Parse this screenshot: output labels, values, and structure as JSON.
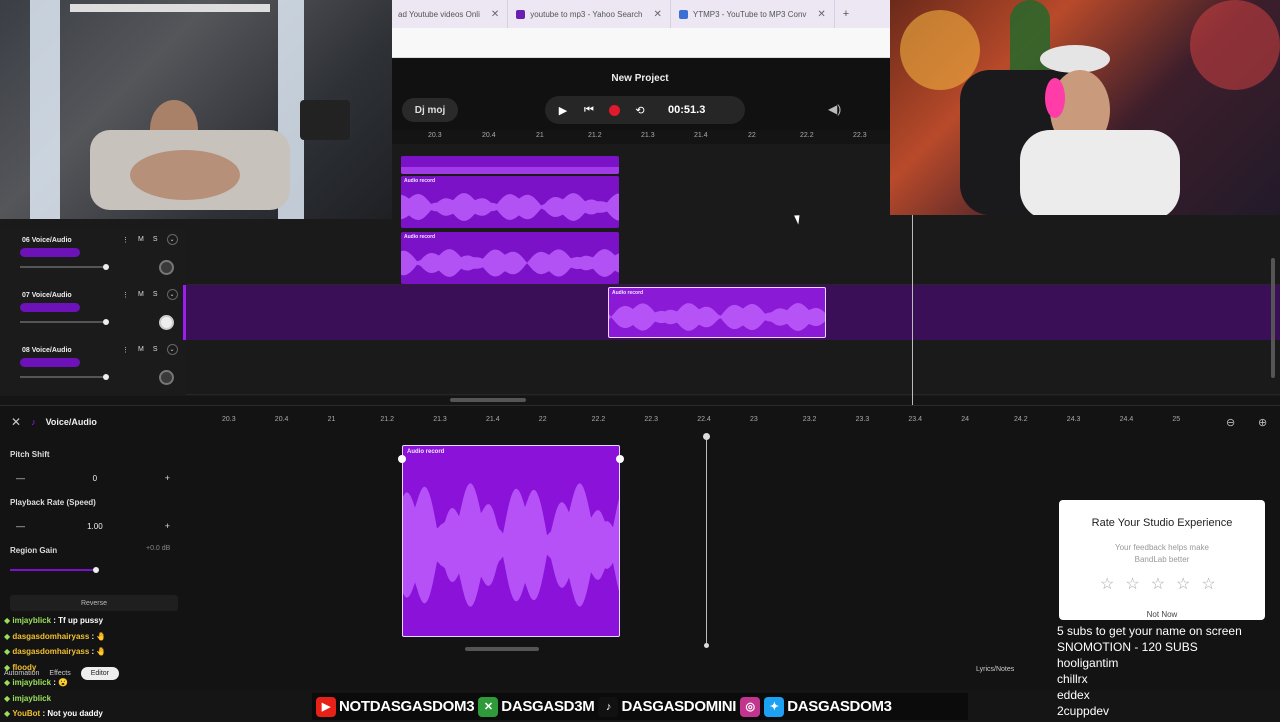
{
  "browser": {
    "tabs": [
      {
        "label": "ad Youtube videos Onli",
        "color": "#e23a3a"
      },
      {
        "label": "youtube to mp3 - Yahoo Search",
        "color": "#6b1fb1"
      },
      {
        "label": "YTMP3 - YouTube to MP3 Conv",
        "color": "#3b6fd6"
      }
    ],
    "new_tab": "+"
  },
  "daw": {
    "project_title": "New Project",
    "logo_label": "Dj moj",
    "time": "00:51.3",
    "top_ruler": [
      "20.3",
      "20.4",
      "21",
      "21.2",
      "21.3",
      "21.4",
      "22",
      "22.2",
      "22.3"
    ],
    "tracks": [
      {
        "name": "06 Voice/Audio",
        "mute": "M",
        "solo": "S"
      },
      {
        "name": "07 Voice/Audio",
        "mute": "M",
        "solo": "S"
      },
      {
        "name": "08 Voice/Audio",
        "mute": "M",
        "solo": "S"
      }
    ],
    "clip_label": "Audio record"
  },
  "editor": {
    "title": "Voice/Audio",
    "pitch_label": "Pitch Shift",
    "pitch_value": "0",
    "rate_label": "Playback Rate (Speed)",
    "rate_value": "1.00",
    "gain_label": "Region Gain",
    "gain_value": "+0.0 dB",
    "reverse_label": "Reverse",
    "bottom_ruler": [
      "20.3",
      "20.4",
      "21",
      "21.2",
      "21.3",
      "21.4",
      "22",
      "22.2",
      "22.3",
      "22.4",
      "23",
      "23.2",
      "23.3",
      "23.4",
      "24",
      "24.2",
      "24.3",
      "24.4",
      "25"
    ],
    "clip_label": "Audio record",
    "tab_automation": "Automation",
    "tab_effects": "Effects",
    "tab_editor": "Editor",
    "lyrics_label": "Lyrics/Notes"
  },
  "rating": {
    "title": "Rate Your Studio Experience",
    "subtitle": "Your feedback helps make BandLab better",
    "not_now": "Not Now"
  },
  "overlay": {
    "subs": [
      "5 subs to get your name on screen",
      "SNOMOTION - 120 SUBS",
      "hooligantim",
      "chillrx",
      "eddex",
      "2cuppdev"
    ],
    "chat": [
      {
        "user": "imjayblick",
        "msg": ": Tf up pussy",
        "green": true
      },
      {
        "user": "dasgasdomhairyass",
        "msg": ": 🤚",
        "green": false
      },
      {
        "user": "dasgasdomhairyass",
        "msg": ": 🤚",
        "green": false
      },
      {
        "user": "floody",
        "msg": "",
        "green": false
      },
      {
        "user": "imjayblick",
        "msg": ": 😮",
        "green": true
      },
      {
        "user": "imjayblick",
        "msg": "",
        "green": true
      },
      {
        "user": "YouBot",
        "msg": ": Not you daddy",
        "green": false
      }
    ],
    "socials": [
      {
        "icon": "youtube-icon",
        "label": "NOTDASGASDOM3",
        "color": "#e62117"
      },
      {
        "icon": "xbox-icon",
        "label": "DASGASD3M",
        "color": "#2e9a3a"
      },
      {
        "icon": "tiktok-icon",
        "label": "DASGASDOMINI",
        "color": "#111111"
      },
      {
        "icon": "instagram-icon",
        "label": "",
        "color": "#c1358e"
      },
      {
        "icon": "twitter-icon",
        "label": "DASGASDOM3",
        "color": "#1da1f2"
      }
    ]
  },
  "colors": {
    "clip": "#7b12c8",
    "accent": "#9b1ef0",
    "record": "#e0192c"
  }
}
